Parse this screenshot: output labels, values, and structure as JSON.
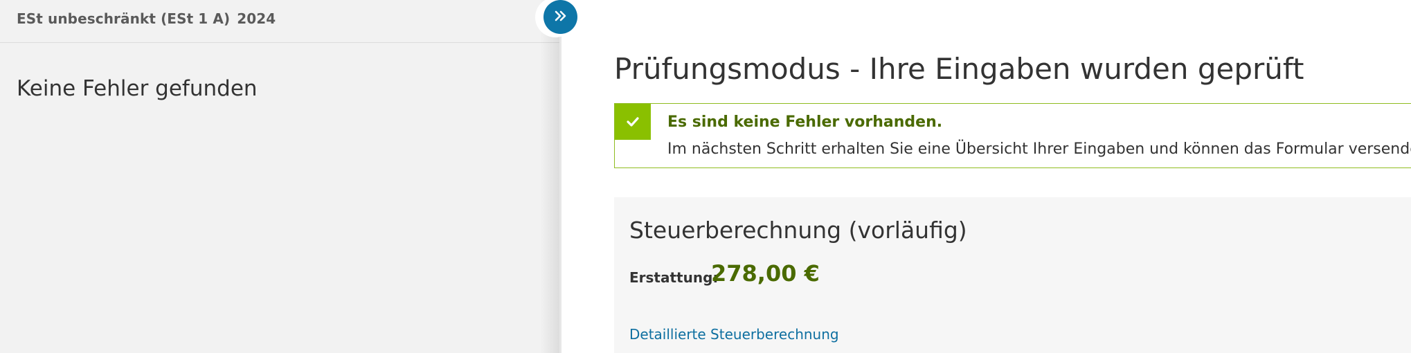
{
  "sidebar": {
    "form_title": "ESt unbeschränkt (ESt 1 A)",
    "year": "2024",
    "message": "Keine Fehler gefunden"
  },
  "toggle": {
    "icon": "double-chevron-right-icon"
  },
  "main": {
    "title": "Prüfungsmodus - Ihre Eingaben wurden geprüft",
    "success": {
      "icon": "checkmark-icon",
      "title": "Es sind keine Fehler vorhanden.",
      "text": "Im nächsten Schritt erhalten Sie eine Übersicht Ihrer Eingaben und können das Formular versenden."
    },
    "tax": {
      "title": "Steuerberechnung (vorläufig)",
      "refund_label": "Erstattung:",
      "refund_amount": "278,00 €",
      "detail_link": "Detaillierte Steuerberechnung"
    }
  },
  "colors": {
    "accent_blue": "#0e76a8",
    "success_green": "#8ac000",
    "success_text": "#4a6a00",
    "sidebar_bg": "#f2f2f2",
    "card_bg": "#f6f6f6"
  }
}
